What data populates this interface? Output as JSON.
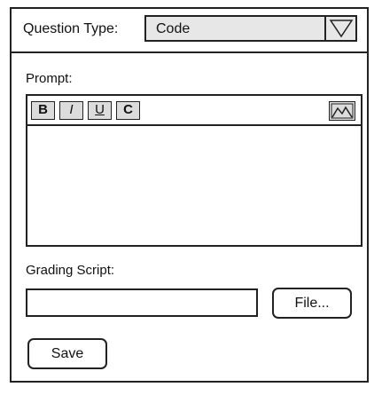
{
  "header": {
    "question_type_label": "Question Type:",
    "question_type_value": "Code"
  },
  "prompt": {
    "label": "Prompt:",
    "toolbar": {
      "bold": "B",
      "italic": "I",
      "underline": "U",
      "code": "C",
      "image_icon": "image-icon"
    },
    "content": ""
  },
  "grading": {
    "label": "Grading Script:",
    "input_value": "",
    "file_button": "File..."
  },
  "actions": {
    "save": "Save"
  }
}
